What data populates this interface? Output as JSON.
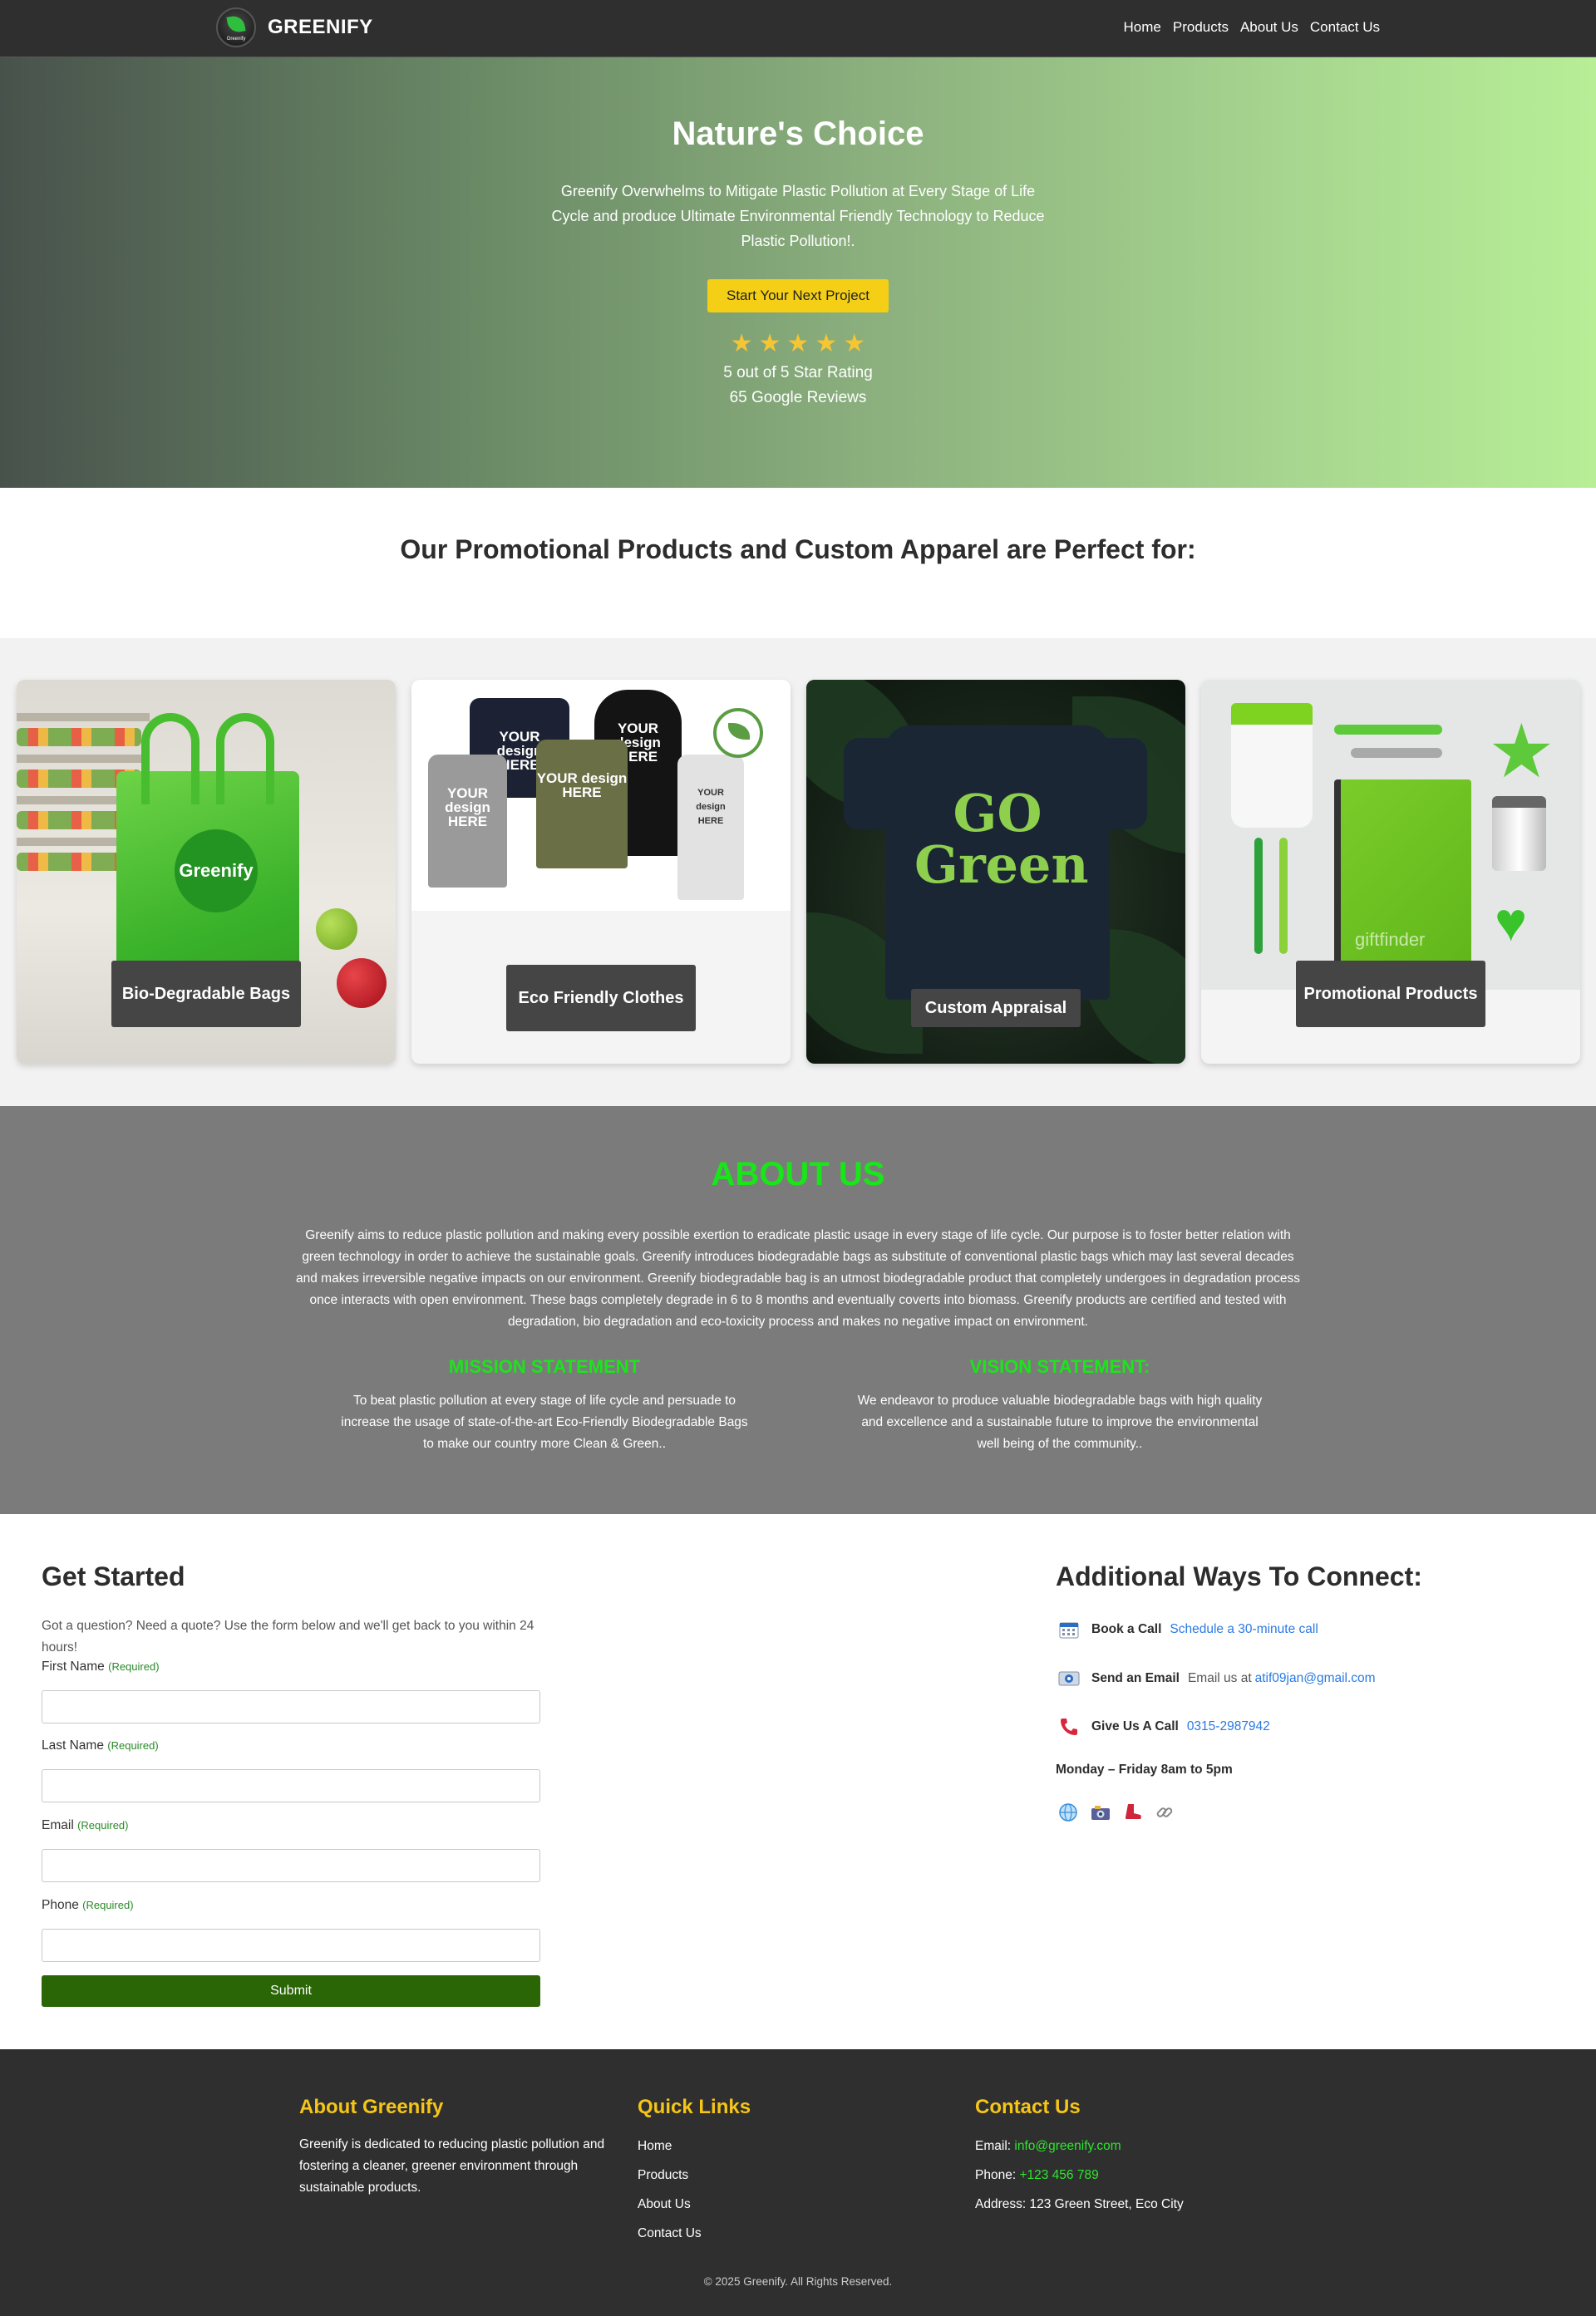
{
  "nav": {
    "logo_text": "GREENIFY",
    "logo_mini": "Greenify",
    "links": [
      "Home",
      "Products",
      "About Us",
      "Contact Us"
    ]
  },
  "hero": {
    "title": "Nature's Choice",
    "description": "Greenify Overwhelms to Mitigate Plastic Pollution at Every Stage of Life Cycle and produce Ultimate Environmental Friendly Technology to Reduce Plastic Pollution!.",
    "cta": "Start Your Next Project",
    "stars": 5,
    "rating_text": "5 out of 5 Star Rating",
    "reviews_text": "65 Google Reviews",
    "star_glyph": "★"
  },
  "perfect": {
    "title": "Our Promotional Products and Custom Apparel are Perfect for:"
  },
  "cards": [
    {
      "label": "Bio-Degradable Bags",
      "image_text": "Greenify"
    },
    {
      "label": "Eco Friendly Clothes",
      "image_text": "YOUR design HERE"
    },
    {
      "label": "Custom Appraisal",
      "image_text": "GO Green"
    },
    {
      "label": "Promotional Products",
      "image_text": "giftfinder"
    }
  ],
  "about": {
    "title": "ABOUT US",
    "text": "Greenify aims to reduce plastic pollution and making every possible exertion to eradicate plastic usage in every stage of life cycle. Our purpose is to foster better relation with green technology in order to achieve the sustainable goals. Greenify introduces biodegradable bags as substitute of conventional plastic bags which may last several decades and makes irreversible negative impacts on our environment. Greenify biodegradable bag is an utmost biodegradable product that completely undergoes in degradation process once interacts with open environment. These bags completely degrade in 6 to 8 months and eventually coverts into biomass. Greenify products are certified and tested with degradation, bio degradation and eco-toxicity process and makes no negative impact on environment.",
    "mission_title": "MISSION STATEMENT",
    "mission_text": "To beat plastic pollution at every stage of life cycle and persuade to increase the usage of state-of-the-art Eco-Friendly Biodegradable Bags to make our country more Clean & Green..",
    "vision_title": "VISION STATEMENT:",
    "vision_text": "We endeavor to produce valuable biodegradable bags with high quality and excellence and a sustainable future to improve the environmental well being of the community.."
  },
  "form": {
    "title": "Get Started",
    "description": "Got a question? Need a quote? Use the form below and we'll get back to you within 24 hours!",
    "required_text": "(Required)",
    "fields": [
      "First Name",
      "Last Name",
      "Email",
      "Phone"
    ],
    "submit": "Submit"
  },
  "connect": {
    "title": "Additional Ways To Connect:",
    "book_label": "Book a Call",
    "book_link": "Schedule a 30-minute call",
    "email_label": "Send an Email",
    "email_prefix": "Email us at",
    "email_link": "atif09jan@gmail.com",
    "call_label": "Give Us A Call",
    "call_link": "0315-2987942",
    "hours": "Monday – Friday 8am to 5pm",
    "icons": [
      "calendar-icon",
      "email-icon",
      "phone-icon",
      "globe-icon",
      "camera-icon",
      "boot-icon",
      "link-icon"
    ]
  },
  "footer": {
    "about_title": "About Greenify",
    "about_text": "Greenify is dedicated to reducing plastic pollution and fostering a cleaner, greener environment through sustainable products.",
    "links_title": "Quick Links",
    "links": [
      "Home",
      "Products",
      "About Us",
      "Contact Us"
    ],
    "contact_title": "Contact Us",
    "email_label": "Email:",
    "email": "info@greenify.com",
    "phone_label": "Phone:",
    "phone": "+123 456 789",
    "address_label": "Address:",
    "address": "123 Green Street, Eco City",
    "copyright": "© 2025 Greenify. All Rights Reserved."
  },
  "colors": {
    "accent_green": "#19e619",
    "cta_yellow": "#f5cf16",
    "submit_green": "#2a6506",
    "footer_title": "#f5c518",
    "link_blue": "#2a7ae2"
  }
}
